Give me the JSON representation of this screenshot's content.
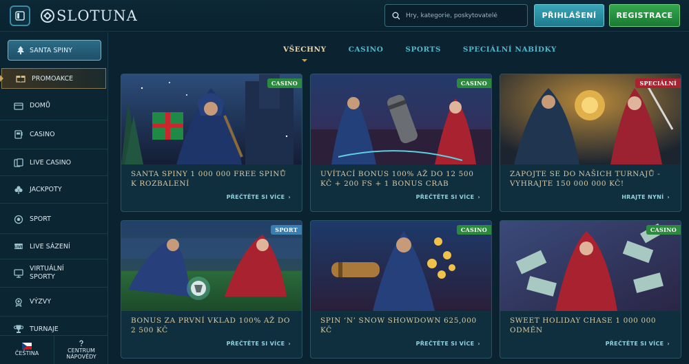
{
  "header": {
    "logo_text": "SLOTUNA",
    "search_placeholder": "Hry, kategorie, poskytovatelé",
    "login_label": "PŘIHLÁŠENÍ",
    "register_label": "REGISTRACE"
  },
  "sidebar": {
    "santa_button": "SANTA SPINY",
    "items": [
      {
        "label": "PROMOAKCE",
        "icon": "promo-icon",
        "active": true
      },
      {
        "label": "DOMŮ",
        "icon": "home-icon"
      },
      {
        "label": "CASINO",
        "icon": "slot-machine-icon"
      },
      {
        "label": "LIVE CASINO",
        "icon": "live-cards-icon"
      },
      {
        "label": "JACKPOTY",
        "icon": "clover-icon"
      },
      {
        "label": "SPORT",
        "icon": "soccer-ball-icon"
      },
      {
        "label": "LIVE SÁZENÍ",
        "icon": "live-badge-icon"
      },
      {
        "label": "VIRTUÁLNÍ SPORTY",
        "icon": "virtual-monitor-icon"
      },
      {
        "label": "VÝZVY",
        "icon": "medal-icon"
      },
      {
        "label": "TURNAJE",
        "icon": "trophy-icon"
      }
    ],
    "footer": {
      "language": "ČEŠTINA",
      "help": "CENTRUM NÁPOVĚDY"
    }
  },
  "tabs": [
    {
      "label": "VŠECHNY",
      "active": true
    },
    {
      "label": "CASINO"
    },
    {
      "label": "SPORTS"
    },
    {
      "label": "SPECIÁLNÍ NABÍDKY"
    }
  ],
  "cards": [
    {
      "badge": "CASINO",
      "badge_color": "#2b8a3e",
      "title": "Santa spiny 1 000 000 free spinů k rozbalení",
      "link": "PŘEČTĚTE SI VÍCE",
      "scene": "snowy-night-mage-gift"
    },
    {
      "badge": "CASINO",
      "badge_color": "#2b8a3e",
      "title": "Uvítací bonus 100% až do 12 500 Kč + 200 FS + 1 Bonus Crab",
      "link": "PŘEČTĚTE SI VÍCE",
      "scene": "two-heroes-scroll"
    },
    {
      "badge": "SPECIÁLNÍ",
      "badge_color": "#a8232f",
      "title": "Zapojte se do našich turnajů - vyhrajte 150 000 000 Kč!",
      "link": "HRAJTE NYNÍ",
      "scene": "heroes-golden-orb"
    },
    {
      "badge": "SPORT",
      "badge_color": "#3b7fb0",
      "title": "Bonus za první vklad 100% až do 2 500 Kč",
      "link": "PŘEČTĚTE SI VÍCE",
      "scene": "stadium-football-duel"
    },
    {
      "badge": "CASINO",
      "badge_color": "#2b8a3e",
      "title": "Spin ‘n’ Snow Showdown 625,000 Kč",
      "link": "PŘEČTĚTE SI VÍCE",
      "scene": "hero-gold-coins"
    },
    {
      "badge": "CASINO",
      "badge_color": "#2b8a3e",
      "title": "Sweet Holiday Chase 1 000 000 odměn",
      "link": "PŘEČTĚTE SI VÍCE",
      "scene": "red-hood-money"
    }
  ]
}
